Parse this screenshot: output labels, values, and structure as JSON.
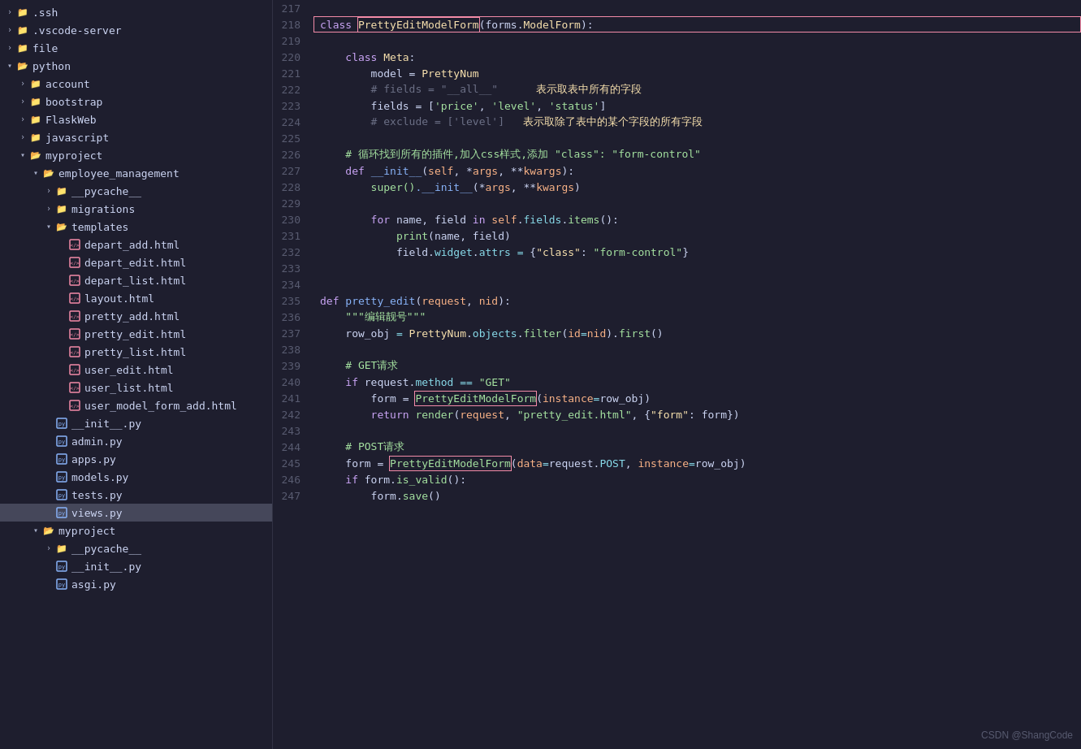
{
  "sidebar": {
    "items": [
      {
        "id": "ssh",
        "label": ".ssh",
        "level": 0,
        "type": "folder",
        "arrow": "closed"
      },
      {
        "id": "vscode-server",
        "label": ".vscode-server",
        "level": 0,
        "type": "folder",
        "arrow": "closed"
      },
      {
        "id": "file",
        "label": "file",
        "level": 0,
        "type": "folder",
        "arrow": "closed"
      },
      {
        "id": "python",
        "label": "python",
        "level": 0,
        "type": "folder",
        "arrow": "open"
      },
      {
        "id": "account",
        "label": "account",
        "level": 1,
        "type": "folder",
        "arrow": "closed"
      },
      {
        "id": "bootstrap",
        "label": "bootstrap",
        "level": 1,
        "type": "folder",
        "arrow": "closed"
      },
      {
        "id": "flaskweb",
        "label": "FlaskWeb",
        "level": 1,
        "type": "folder",
        "arrow": "closed"
      },
      {
        "id": "javascript",
        "label": "javascript",
        "level": 1,
        "type": "folder",
        "arrow": "closed"
      },
      {
        "id": "myproject",
        "label": "myproject",
        "level": 1,
        "type": "folder",
        "arrow": "open"
      },
      {
        "id": "employee_management",
        "label": "employee_management",
        "level": 2,
        "type": "folder",
        "arrow": "open"
      },
      {
        "id": "pycache1",
        "label": "__pycache__",
        "level": 3,
        "type": "folder",
        "arrow": "closed"
      },
      {
        "id": "migrations",
        "label": "migrations",
        "level": 3,
        "type": "folder",
        "arrow": "closed"
      },
      {
        "id": "templates",
        "label": "templates",
        "level": 3,
        "type": "folder",
        "arrow": "open"
      },
      {
        "id": "depart_add",
        "label": "depart_add.html",
        "level": 4,
        "type": "html",
        "arrow": "none"
      },
      {
        "id": "depart_edit",
        "label": "depart_edit.html",
        "level": 4,
        "type": "html",
        "arrow": "none"
      },
      {
        "id": "depart_list",
        "label": "depart_list.html",
        "level": 4,
        "type": "html",
        "arrow": "none"
      },
      {
        "id": "layout",
        "label": "layout.html",
        "level": 4,
        "type": "html",
        "arrow": "none"
      },
      {
        "id": "pretty_add",
        "label": "pretty_add.html",
        "level": 4,
        "type": "html",
        "arrow": "none"
      },
      {
        "id": "pretty_edit",
        "label": "pretty_edit.html",
        "level": 4,
        "type": "html",
        "arrow": "none"
      },
      {
        "id": "pretty_list",
        "label": "pretty_list.html",
        "level": 4,
        "type": "html",
        "arrow": "none"
      },
      {
        "id": "user_edit",
        "label": "user_edit.html",
        "level": 4,
        "type": "html",
        "arrow": "none"
      },
      {
        "id": "user_list",
        "label": "user_list.html",
        "level": 4,
        "type": "html",
        "arrow": "none"
      },
      {
        "id": "user_model_form_add",
        "label": "user_model_form_add.html",
        "level": 4,
        "type": "html",
        "arrow": "none"
      },
      {
        "id": "init1",
        "label": "__init__.py",
        "level": 3,
        "type": "py",
        "arrow": "none"
      },
      {
        "id": "admin",
        "label": "admin.py",
        "level": 3,
        "type": "py",
        "arrow": "none"
      },
      {
        "id": "apps",
        "label": "apps.py",
        "level": 3,
        "type": "py",
        "arrow": "none"
      },
      {
        "id": "models",
        "label": "models.py",
        "level": 3,
        "type": "py",
        "arrow": "none"
      },
      {
        "id": "tests",
        "label": "tests.py",
        "level": 3,
        "type": "py",
        "arrow": "none"
      },
      {
        "id": "views",
        "label": "views.py",
        "level": 3,
        "type": "py",
        "arrow": "none",
        "selected": true
      },
      {
        "id": "myproject2",
        "label": "myproject",
        "level": 2,
        "type": "folder",
        "arrow": "open"
      },
      {
        "id": "pycache2",
        "label": "__pycache__",
        "level": 3,
        "type": "folder",
        "arrow": "closed"
      },
      {
        "id": "init2",
        "label": "__init__.py",
        "level": 3,
        "type": "py",
        "arrow": "none"
      },
      {
        "id": "asgi",
        "label": "asgi.py",
        "level": 3,
        "type": "py",
        "arrow": "none"
      }
    ]
  },
  "watermark": "CSDN @ShangCode",
  "lines": [
    {
      "num": 217,
      "tokens": []
    },
    {
      "num": 218,
      "highlight": true,
      "tokens": [
        {
          "t": "class ",
          "c": "kw"
        },
        {
          "t": "PrettyEditModelForm",
          "c": "cls",
          "box": true
        },
        {
          "t": "(",
          "c": "punc"
        },
        {
          "t": "forms",
          "c": "var"
        },
        {
          "t": ".",
          "c": "punc"
        },
        {
          "t": "ModelForm",
          "c": "cls"
        },
        {
          "t": ")",
          "c": "punc"
        },
        {
          "t": ":",
          "c": "punc"
        }
      ]
    },
    {
      "num": 219,
      "tokens": []
    },
    {
      "num": 220,
      "tokens": [
        {
          "t": "    class ",
          "c": "kw"
        },
        {
          "t": "Meta",
          "c": "cls"
        },
        {
          "t": ":",
          "c": "punc"
        }
      ]
    },
    {
      "num": 221,
      "tokens": [
        {
          "t": "        model = ",
          "c": "var"
        },
        {
          "t": "PrettyNum",
          "c": "cls"
        }
      ]
    },
    {
      "num": 222,
      "tokens": [
        {
          "t": "        # fields = \"__all__\"",
          "c": "cmt"
        },
        {
          "t": "      表示取表中所有的字段",
          "c": "cn"
        }
      ]
    },
    {
      "num": 223,
      "tokens": [
        {
          "t": "        fields = ",
          "c": "var"
        },
        {
          "t": "[",
          "c": "punc"
        },
        {
          "t": "'price'",
          "c": "str"
        },
        {
          "t": ", ",
          "c": "punc"
        },
        {
          "t": "'level'",
          "c": "str"
        },
        {
          "t": ", ",
          "c": "punc"
        },
        {
          "t": "'status'",
          "c": "str"
        },
        {
          "t": "]",
          "c": "punc"
        }
      ]
    },
    {
      "num": 224,
      "tokens": [
        {
          "t": "        # exclude = ['level']",
          "c": "cmt"
        },
        {
          "t": "   表示取除了表中的某个字段的所有字段",
          "c": "cn"
        }
      ]
    },
    {
      "num": 225,
      "tokens": []
    },
    {
      "num": 226,
      "tokens": [
        {
          "t": "    # 循环找到所有的插件,加入css样式,添加 \"class\": \"form-control\"",
          "c": "cmt2"
        }
      ]
    },
    {
      "num": 227,
      "tokens": [
        {
          "t": "    def ",
          "c": "kw"
        },
        {
          "t": "__init__",
          "c": "fn"
        },
        {
          "t": "(",
          "c": "punc"
        },
        {
          "t": "self",
          "c": "param"
        },
        {
          "t": ", *",
          "c": "punc"
        },
        {
          "t": "args",
          "c": "param"
        },
        {
          "t": ", **",
          "c": "punc"
        },
        {
          "t": "kwargs",
          "c": "param"
        },
        {
          "t": ")",
          "c": "punc"
        },
        {
          "t": ":",
          "c": "punc"
        }
      ]
    },
    {
      "num": 228,
      "tokens": [
        {
          "t": "        super()",
          "c": "fn2"
        },
        {
          "t": ".__init__",
          "c": "fn"
        },
        {
          "t": "(*",
          "c": "punc"
        },
        {
          "t": "args",
          "c": "param"
        },
        {
          "t": ", **",
          "c": "punc"
        },
        {
          "t": "kwargs",
          "c": "param"
        },
        {
          "t": ")",
          "c": "punc"
        }
      ]
    },
    {
      "num": 229,
      "tokens": []
    },
    {
      "num": 230,
      "tokens": [
        {
          "t": "        for ",
          "c": "kw"
        },
        {
          "t": "name",
          "c": "var"
        },
        {
          "t": ", ",
          "c": "punc"
        },
        {
          "t": "field ",
          "c": "var"
        },
        {
          "t": "in ",
          "c": "kw"
        },
        {
          "t": "self",
          "c": "param"
        },
        {
          "t": ".",
          "c": "punc"
        },
        {
          "t": "fields",
          "c": "attr"
        },
        {
          "t": ".",
          "c": "punc"
        },
        {
          "t": "items",
          "c": "fn2"
        },
        {
          "t": "():",
          "c": "punc"
        }
      ]
    },
    {
      "num": 231,
      "tokens": [
        {
          "t": "            print",
          "c": "fn2"
        },
        {
          "t": "(",
          "c": "punc"
        },
        {
          "t": "name",
          "c": "var"
        },
        {
          "t": ", ",
          "c": "punc"
        },
        {
          "t": "field",
          "c": "var"
        },
        {
          "t": ")",
          "c": "punc"
        }
      ]
    },
    {
      "num": 232,
      "tokens": [
        {
          "t": "            field",
          "c": "var"
        },
        {
          "t": ".",
          "c": "punc"
        },
        {
          "t": "widget",
          "c": "attr"
        },
        {
          "t": ".",
          "c": "punc"
        },
        {
          "t": "attrs ",
          "c": "attr"
        },
        {
          "t": "= ",
          "c": "op"
        },
        {
          "t": "{",
          "c": "punc"
        },
        {
          "t": "\"class\"",
          "c": "str2"
        },
        {
          "t": ": ",
          "c": "punc"
        },
        {
          "t": "\"form-control\"",
          "c": "str"
        },
        {
          "t": "}",
          "c": "punc"
        }
      ]
    },
    {
      "num": 233,
      "tokens": []
    },
    {
      "num": 234,
      "tokens": []
    },
    {
      "num": 235,
      "tokens": [
        {
          "t": "def ",
          "c": "kw"
        },
        {
          "t": "pretty_edit",
          "c": "fn"
        },
        {
          "t": "(",
          "c": "punc"
        },
        {
          "t": "request",
          "c": "param"
        },
        {
          "t": ", ",
          "c": "punc"
        },
        {
          "t": "nid",
          "c": "param"
        },
        {
          "t": ")",
          "c": "punc"
        },
        {
          "t": ":",
          "c": "punc"
        }
      ]
    },
    {
      "num": 236,
      "tokens": [
        {
          "t": "    \"\"\"",
          "c": "str"
        },
        {
          "t": "编辑靓号",
          "c": "str"
        },
        {
          "t": "\"\"\"",
          "c": "str"
        }
      ]
    },
    {
      "num": 237,
      "tokens": [
        {
          "t": "    row_obj ",
          "c": "var"
        },
        {
          "t": "= ",
          "c": "op"
        },
        {
          "t": "PrettyNum",
          "c": "cls"
        },
        {
          "t": ".",
          "c": "punc"
        },
        {
          "t": "objects",
          "c": "attr"
        },
        {
          "t": ".",
          "c": "punc"
        },
        {
          "t": "filter",
          "c": "fn2"
        },
        {
          "t": "(",
          "c": "punc"
        },
        {
          "t": "id",
          "c": "param"
        },
        {
          "t": "=",
          "c": "op"
        },
        {
          "t": "nid",
          "c": "param"
        },
        {
          "t": ")",
          "c": "punc"
        },
        {
          "t": ".",
          "c": "punc"
        },
        {
          "t": "first",
          "c": "fn2"
        },
        {
          "t": "()",
          "c": "punc"
        }
      ]
    },
    {
      "num": 238,
      "tokens": []
    },
    {
      "num": 239,
      "tokens": [
        {
          "t": "    # GET请求",
          "c": "cmt2"
        }
      ]
    },
    {
      "num": 240,
      "tokens": [
        {
          "t": "    if ",
          "c": "kw"
        },
        {
          "t": "request",
          "c": "var"
        },
        {
          "t": ".",
          "c": "punc"
        },
        {
          "t": "method ",
          "c": "attr"
        },
        {
          "t": "== ",
          "c": "op"
        },
        {
          "t": "\"GET\"",
          "c": "str"
        }
      ]
    },
    {
      "num": 241,
      "highlight2": true,
      "tokens": [
        {
          "t": "        form = ",
          "c": "var"
        },
        {
          "t": "PrettyEditModelForm",
          "c": "cls2",
          "box": true
        },
        {
          "t": "(",
          "c": "punc"
        },
        {
          "t": "instance",
          "c": "param"
        },
        {
          "t": "=",
          "c": "op"
        },
        {
          "t": "row_obj",
          "c": "var"
        },
        {
          "t": ")",
          "c": "punc"
        }
      ]
    },
    {
      "num": 242,
      "tokens": [
        {
          "t": "        return ",
          "c": "kw"
        },
        {
          "t": "render",
          "c": "fn2"
        },
        {
          "t": "(",
          "c": "punc"
        },
        {
          "t": "request",
          "c": "param"
        },
        {
          "t": ", ",
          "c": "punc"
        },
        {
          "t": "\"pretty_edit.html\"",
          "c": "str"
        },
        {
          "t": ", ",
          "c": "punc"
        },
        {
          "t": "{",
          "c": "punc"
        },
        {
          "t": "\"form\"",
          "c": "str2"
        },
        {
          "t": ": ",
          "c": "punc"
        },
        {
          "t": "form",
          "c": "var"
        },
        {
          "t": "}",
          "c": "punc"
        },
        {
          "t": ")",
          "c": "punc"
        }
      ]
    },
    {
      "num": 243,
      "tokens": []
    },
    {
      "num": 244,
      "tokens": [
        {
          "t": "    # POST请求",
          "c": "cmt2"
        }
      ]
    },
    {
      "num": 245,
      "highlight3": true,
      "tokens": [
        {
          "t": "    form = ",
          "c": "var"
        },
        {
          "t": "PrettyEditModelForm",
          "c": "cls2",
          "box": true
        },
        {
          "t": "(",
          "c": "punc"
        },
        {
          "t": "data",
          "c": "param"
        },
        {
          "t": "=",
          "c": "op"
        },
        {
          "t": "request",
          "c": "var"
        },
        {
          "t": ".",
          "c": "punc"
        },
        {
          "t": "POST",
          "c": "attr"
        },
        {
          "t": ", ",
          "c": "punc"
        },
        {
          "t": "instance",
          "c": "param"
        },
        {
          "t": "=",
          "c": "op"
        },
        {
          "t": "row_obj",
          "c": "var"
        },
        {
          "t": ")",
          "c": "punc"
        }
      ]
    },
    {
      "num": 246,
      "tokens": [
        {
          "t": "    if ",
          "c": "kw"
        },
        {
          "t": "form",
          "c": "var"
        },
        {
          "t": ".",
          "c": "punc"
        },
        {
          "t": "is_valid",
          "c": "fn2"
        },
        {
          "t": "():",
          "c": "punc"
        }
      ]
    },
    {
      "num": 247,
      "tokens": [
        {
          "t": "        form",
          "c": "var"
        },
        {
          "t": ".",
          "c": "punc"
        },
        {
          "t": "save",
          "c": "fn2"
        },
        {
          "t": "()",
          "c": "punc"
        }
      ]
    }
  ]
}
